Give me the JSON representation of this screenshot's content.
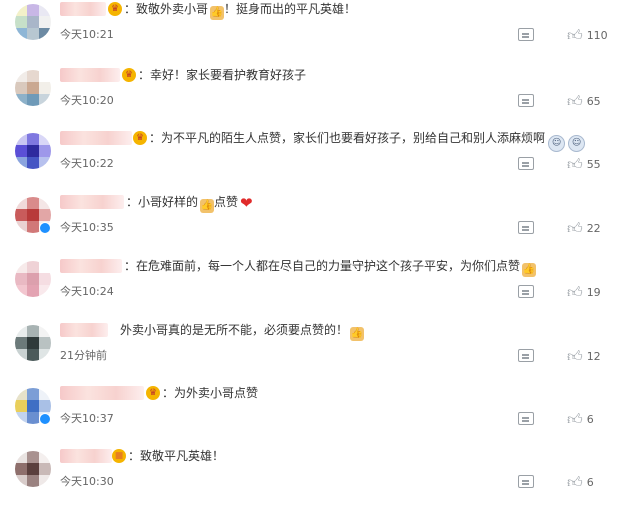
{
  "icons": {
    "reply": "reply-icon",
    "like": "thumbs-up-icon",
    "thumb_emoji": "thumbs-up-emoji-icon",
    "face_emoji": "face-emoji-icon",
    "heart_emoji": "heart-icon",
    "medal": "medal-icon"
  },
  "colors": {
    "like_icon": "#9aa0a6",
    "vip_badge": "#1e90ff",
    "heart": "#e02b2b"
  },
  "comments": [
    {
      "text": "：致敬外卖小哥",
      "text_after": "！挺身而出的平凡英雄！",
      "time": "今天10:21",
      "likes": "110"
    },
    {
      "text": "：幸好！家长要看护教育好孩子",
      "text_after": "",
      "time": "今天10:20",
      "likes": "65"
    },
    {
      "text": "：为不平凡的陌生人点赞，家长们也要看好孩子，别给自己和别人添麻烦啊",
      "text_after": "",
      "time": "今天10:22",
      "likes": "55"
    },
    {
      "text": "：小哥好样的",
      "text_after": "点赞",
      "time": "今天10:35",
      "likes": "22"
    },
    {
      "text": "：在危难面前，每一个人都在尽自己的力量守护这个孩子平安，为你们点赞",
      "text_after": "",
      "time": "今天10:24",
      "likes": "19"
    },
    {
      "text": "外卖小哥真的是无所不能，必须要点赞的！",
      "text_after": "",
      "time": "21分钟前",
      "likes": "12"
    },
    {
      "text": "：为外卖小哥点赞",
      "text_after": "",
      "time": "今天10:37",
      "likes": "6"
    },
    {
      "text": "：致敬平凡英雄！",
      "text_after": "",
      "time": "今天10:30",
      "likes": "6"
    }
  ]
}
